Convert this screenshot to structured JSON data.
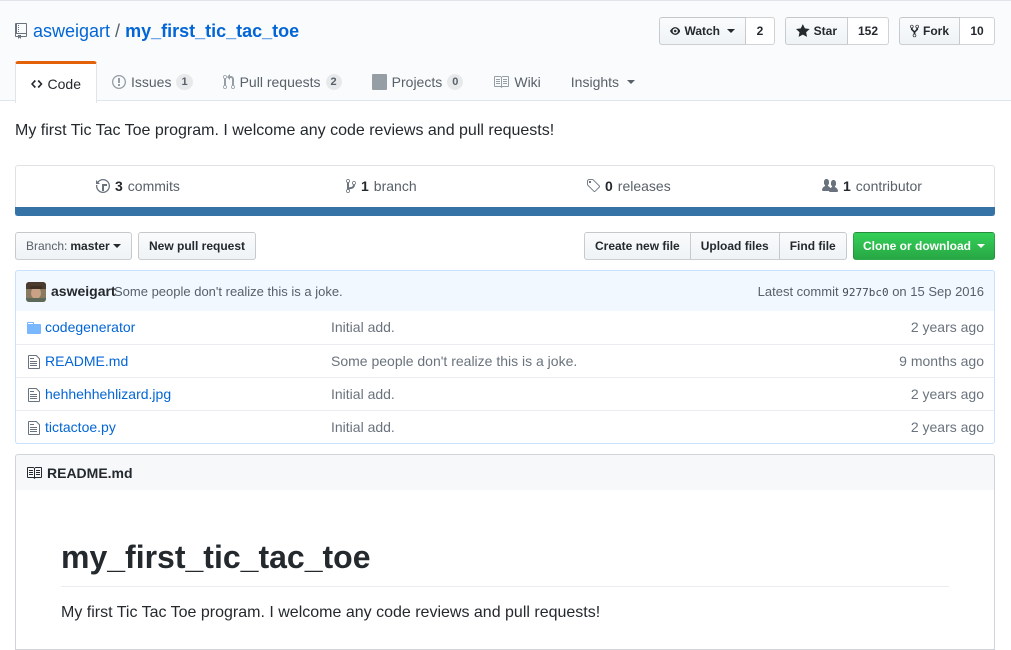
{
  "repo": {
    "owner": "asweigart",
    "separator": "/",
    "name": "my_first_tic_tac_toe"
  },
  "actions": {
    "watch_label": "Watch",
    "watch_count": "2",
    "star_label": "Star",
    "star_count": "152",
    "fork_label": "Fork",
    "fork_count": "10"
  },
  "tabs": [
    {
      "label": "Code",
      "counter": "",
      "icon": "code-icon",
      "selected": true
    },
    {
      "label": "Issues",
      "counter": "1",
      "icon": "issue-icon"
    },
    {
      "label": "Pull requests",
      "counter": "2",
      "icon": "pull-request-icon"
    },
    {
      "label": "Projects",
      "counter": "0",
      "icon": "project-icon"
    },
    {
      "label": "Wiki",
      "counter": "",
      "icon": "book-icon"
    },
    {
      "label": "Insights",
      "counter": "",
      "icon": "dropdown-caret"
    }
  ],
  "description": "My first Tic Tac Toe program. I welcome any code reviews and pull requests!",
  "summary": {
    "commits_count": "3",
    "commits_label": "commits",
    "branch_count": "1",
    "branch_label": "branch",
    "releases_count": "0",
    "releases_label": "releases",
    "contributor_count": "1",
    "contributor_label": "contributor"
  },
  "language_color": "#3572a5",
  "filebar": {
    "branch_prefix": "Branch:",
    "branch_name": "master",
    "new_pr": "New pull request",
    "create_file": "Create new file",
    "upload_files": "Upload files",
    "find_file": "Find file",
    "clone": "Clone or download"
  },
  "commit": {
    "author": "asweigart",
    "message": "Some people don't realize this is a joke.",
    "latest_label": "Latest commit",
    "sha": "9277bc0",
    "date": "on 15 Sep 2016"
  },
  "files": [
    {
      "name": "codegenerator",
      "type": "folder",
      "message": "Initial add.",
      "age": "2 years ago"
    },
    {
      "name": "README.md",
      "type": "file",
      "message": "Some people don't realize this is a joke.",
      "age": "9 months ago"
    },
    {
      "name": "hehhehhehlizard.jpg",
      "type": "file",
      "message": "Initial add.",
      "age": "2 years ago"
    },
    {
      "name": "tictactoe.py",
      "type": "file",
      "message": "Initial add.",
      "age": "2 years ago"
    }
  ],
  "readme": {
    "header": "README.md",
    "title": "my_first_tic_tac_toe",
    "paragraph": "My first Tic Tac Toe program. I welcome any code reviews and pull requests!"
  }
}
